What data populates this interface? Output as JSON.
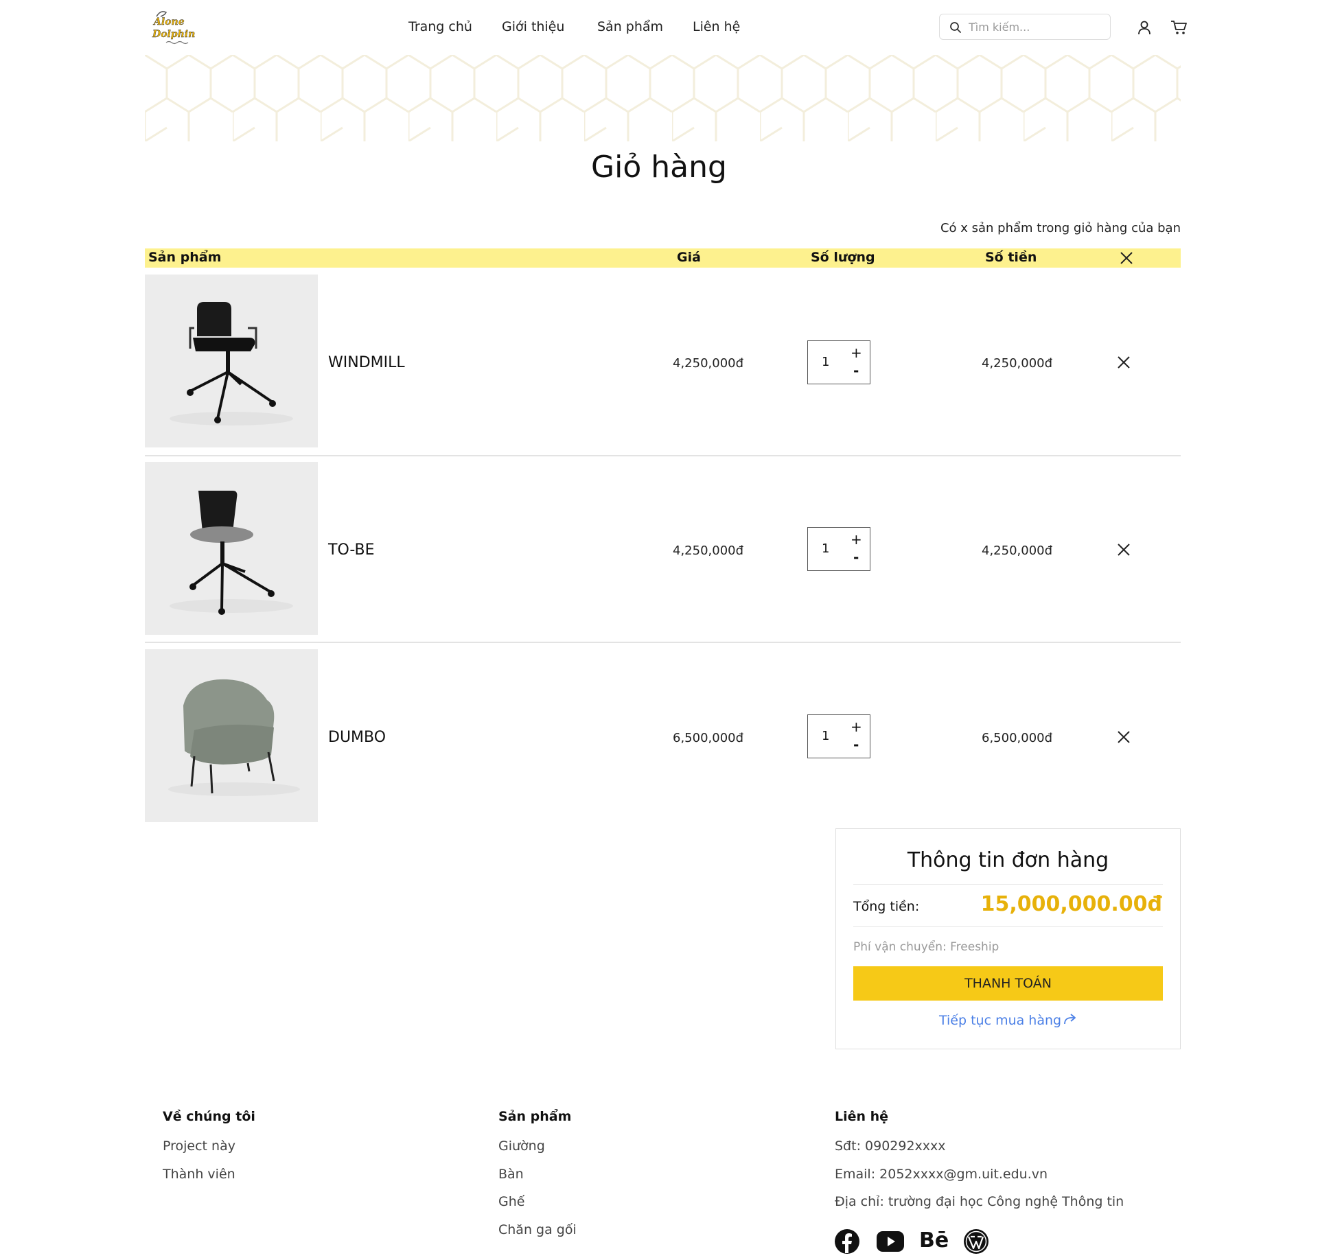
{
  "header": {
    "logo_text": "Alone Dolphin",
    "nav": [
      "Trang chủ",
      "Giới thiệu",
      "Sản phẩm",
      "Liên hệ"
    ],
    "search_placeholder": "Tìm kiếm..."
  },
  "page_title": "Giỏ hàng",
  "cart_count_text": "Có x sản phẩm trong giỏ hàng của bạn",
  "table_headers": {
    "product": "Sản phẩm",
    "price": "Giá",
    "quantity": "Số lượng",
    "amount": "Số tiền"
  },
  "items": [
    {
      "name": "WINDMILL",
      "price": "4,250,000đ",
      "quantity": "1",
      "total": "4,250,000đ"
    },
    {
      "name": "TO-BE",
      "price": "4,250,000đ",
      "quantity": "1",
      "total": "4,250,000đ"
    },
    {
      "name": "DUMBO",
      "price": "6,500,000đ",
      "quantity": "1",
      "total": "6,500,000đ"
    }
  ],
  "qty_controls": {
    "plus": "+",
    "minus": "-"
  },
  "summary": {
    "title": "Thông tin đơn hàng",
    "total_label": "Tổng tiền:",
    "total_value": "15,000,000.00đ",
    "shipping": "Phí vận chuyển: Freeship",
    "pay_button": "THANH TOÁN",
    "continue": "Tiếp tục mua hàng"
  },
  "footer": {
    "about": {
      "title": "Về chúng tôi",
      "links": [
        "Project này",
        "Thành viên"
      ]
    },
    "products": {
      "title": "Sản phẩm",
      "links": [
        "Giường",
        "Bàn",
        "Ghế",
        "Chăn ga gối"
      ]
    },
    "contact": {
      "title": "Liên hệ",
      "phone": "Sđt: 090292xxxx",
      "email": "Email: 2052xxxx@gm.uit.edu.vn",
      "address": "Địa chỉ: trường đại học Công nghệ Thông tin",
      "behance_label": "Bē"
    }
  },
  "colors": {
    "accent_yellow": "#f6c917",
    "table_header": "#fdf18e",
    "total_value": "#e7b10a",
    "link_blue": "#4a7fe6"
  },
  "icons": [
    "search-icon",
    "user-icon",
    "cart-icon",
    "close-icon",
    "share-arrow-icon",
    "facebook-icon",
    "youtube-icon",
    "behance-icon",
    "wordpress-icon"
  ]
}
